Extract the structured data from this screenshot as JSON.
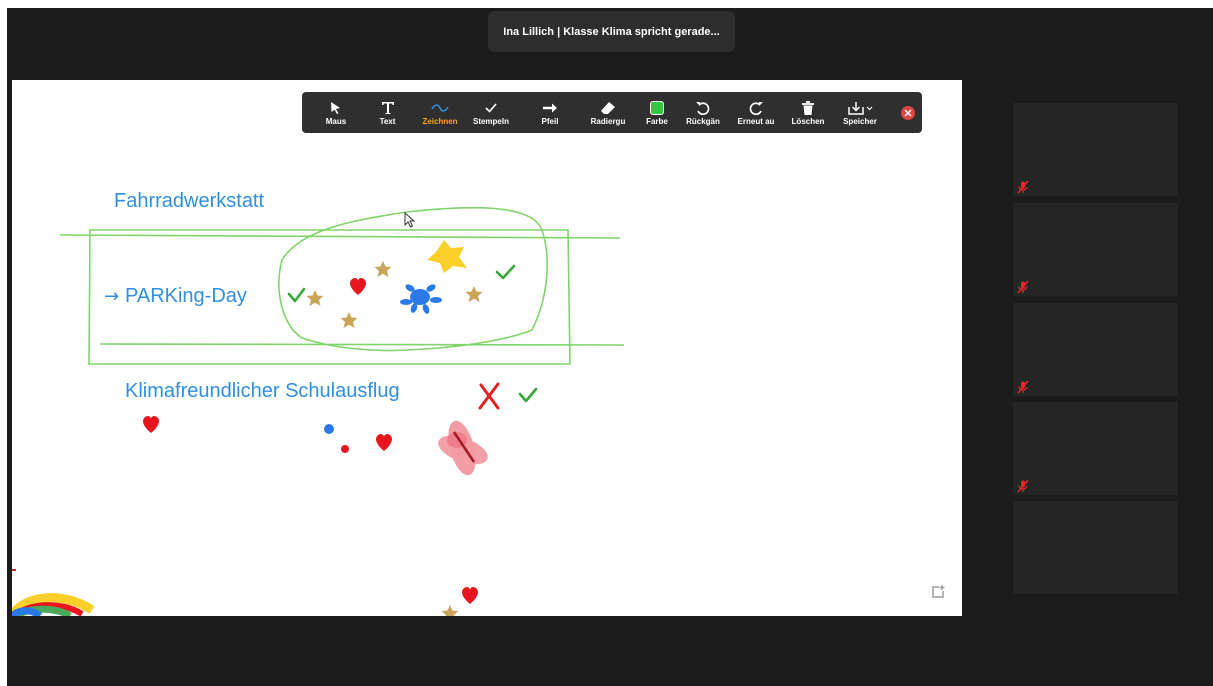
{
  "banner": {
    "speaker_text": "Ina Lillich | Klasse Klima spricht gerade..."
  },
  "toolbar": {
    "tools": [
      {
        "label": "Maus",
        "icon": "cursor-icon",
        "active": false
      },
      {
        "label": "Text",
        "icon": "text-icon",
        "active": false
      },
      {
        "label": "Zeichnen",
        "icon": "draw-icon",
        "active": true
      },
      {
        "label": "Stempeln",
        "icon": "stamp-icon",
        "active": false
      },
      {
        "label": "Pfeil",
        "icon": "arrow-icon",
        "active": false
      },
      {
        "label": "Radiergu",
        "icon": "eraser-icon",
        "active": false
      },
      {
        "label": "Farbe",
        "icon": "color-icon",
        "active": false
      },
      {
        "label": "Rückgän",
        "icon": "undo-icon",
        "active": false
      },
      {
        "label": "Erneut au",
        "icon": "redo-icon",
        "active": false
      },
      {
        "label": "Löschen",
        "icon": "trash-icon",
        "active": false
      },
      {
        "label": "Speicher",
        "icon": "save-icon",
        "active": false
      }
    ],
    "close_icon": "close-icon",
    "active_color": "#f3a71e",
    "pen_color": "#32c840"
  },
  "whiteboard": {
    "texts": {
      "fahrradwerkstatt": "Fahrradwerkstatt",
      "parking_day": "PARKing-Day",
      "schulausflug": "Klimafreundlicher Schulausflug"
    },
    "colors": {
      "text": "#2f8fe0",
      "stroke_green": "#7fd46a",
      "check_green": "#36a837",
      "heart_red": "#e8141e",
      "star_gold": "#c9a55a",
      "star_yellow": "#fbd02a",
      "splat_blue": "#2b78e8",
      "x_red": "#e32020",
      "pink": "#f29ca4"
    }
  },
  "gallery": {
    "tile_count": 5,
    "muted_tiles": 4,
    "mic_icon": "muted-mic-icon"
  },
  "share_icon": "expand-icon"
}
